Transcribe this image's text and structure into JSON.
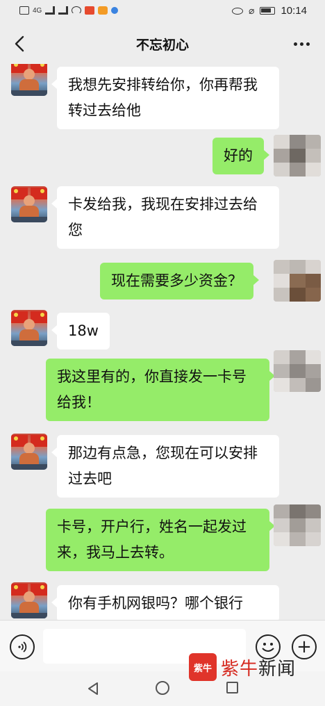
{
  "status_bar": {
    "left_icons": [
      "sim-icon",
      "signal-icon",
      "hd-signal-icon",
      "wifi-icon",
      "notification-red-icon",
      "notification-orange-icon",
      "notification-blue-icon"
    ],
    "signal_label": "4G",
    "right_icons": [
      "eye-icon",
      "mute-icon",
      "battery-icon"
    ],
    "time": "10:14"
  },
  "header": {
    "title": "不忘初心",
    "back_icon": "chevron-left-icon",
    "more_icon": "more-dots-icon"
  },
  "messages": [
    {
      "side": "left",
      "text": "我想先安排转给你，你再帮我转过去给他"
    },
    {
      "side": "right",
      "text": "好的"
    },
    {
      "side": "left",
      "text": "卡发给我，我现在安排过去给您"
    },
    {
      "side": "right",
      "text": "现在需要多少资金？"
    },
    {
      "side": "left",
      "text": "18w"
    },
    {
      "side": "right",
      "text": "我这里有的，你直接发一卡号给我！"
    },
    {
      "side": "left",
      "text": "那边有点急，您现在可以安排过去吧"
    },
    {
      "side": "right",
      "text": "卡号，开户行，姓名一起发过来，我马上去转。"
    },
    {
      "side": "left",
      "text": "你有手机网银吗？哪个银行"
    }
  ],
  "input_bar": {
    "voice_icon": "voice-icon",
    "text_value": "",
    "emoji_icon": "emoji-icon",
    "plus_icon": "plus-icon"
  },
  "watermark": {
    "logo_text": "紫牛",
    "text_red": "紫牛",
    "text_dark": "新闻"
  },
  "system_nav": [
    "back-triangle-icon",
    "home-circle-icon",
    "recent-square-icon"
  ],
  "colors": {
    "background": "#ededed",
    "bubble_left": "#ffffff",
    "bubble_right": "#95ec69",
    "cursor": "#07c160",
    "watermark_red": "#d62a20"
  }
}
